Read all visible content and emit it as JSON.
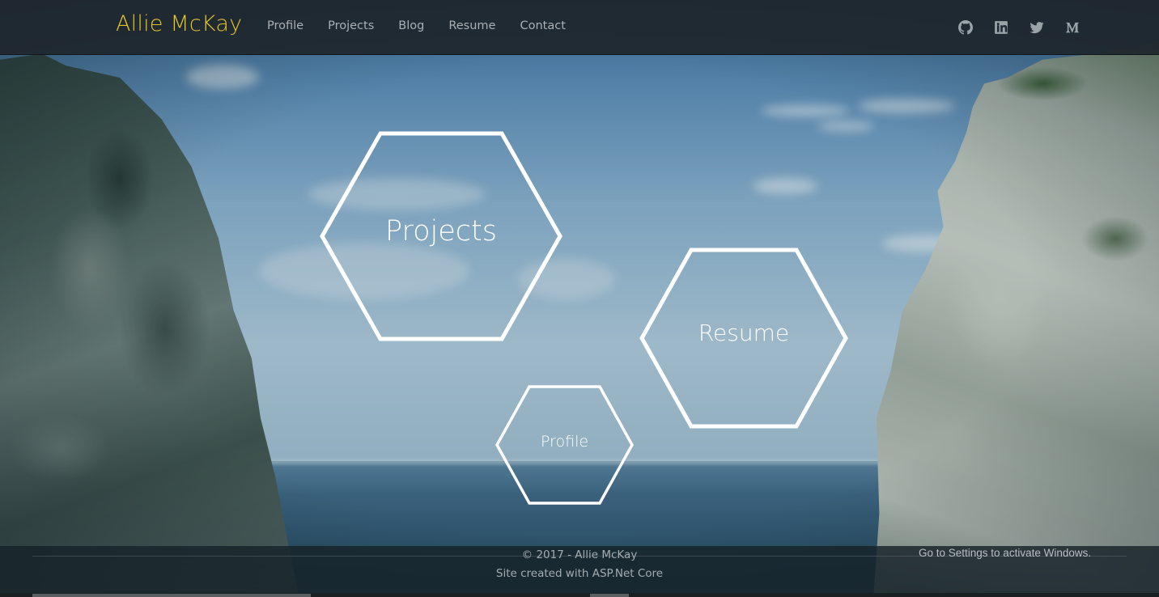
{
  "navbar": {
    "brand": "Allie McKay",
    "links": [
      "Profile",
      "Projects",
      "Blog",
      "Resume",
      "Contact"
    ],
    "social_icons": [
      "github-icon",
      "linkedin-icon",
      "twitter-icon",
      "medium-icon"
    ]
  },
  "hexagons": {
    "projects": "Projects",
    "resume": "Resume",
    "profile": "Profile"
  },
  "footer": {
    "copyright": "© 2017 - Allie McKay",
    "credit": "Site created with ASP.Net Core"
  },
  "os_notice": "Go to Settings to activate Windows.",
  "colors": {
    "brand": "#e3c22c",
    "nav_bg": "#1e262c",
    "nav_link": "#a9b0b4",
    "hex_stroke": "#ffffff"
  }
}
